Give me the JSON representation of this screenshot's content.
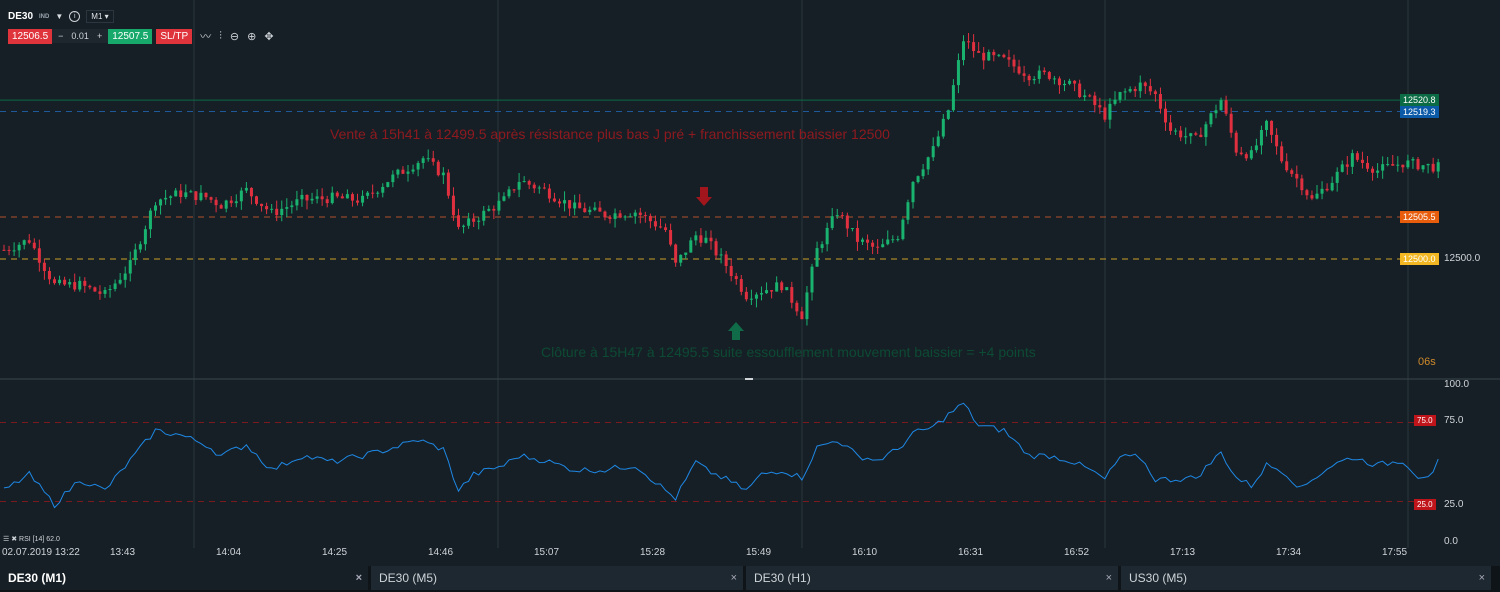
{
  "header": {
    "symbol": "DE30",
    "type": "IND",
    "timeframe": "M1"
  },
  "trade": {
    "bid": "12506.5",
    "lot_minus": "−",
    "lot": "0.01",
    "lot_plus": "+",
    "ask": "12507.5",
    "sltp": "SL/TP"
  },
  "price_labels": [
    {
      "value": "12520.8",
      "color": "#0b6b44"
    },
    {
      "value": "12519.3",
      "color": "#0b5aa8"
    },
    {
      "value": "12505.5",
      "color": "#e85d0c"
    },
    {
      "value": "12500.0",
      "color": "#f2b722"
    }
  ],
  "price_axis": {
    "label": "12500.0",
    "countdown": "06s"
  },
  "annotations": {
    "sell": "Vente à 15h41 à 12499.5 après résistance plus bas J pré + franchissement baissier 12500",
    "close": "Clôture à 15H47 à 12495.5 suite essoufflement mouvement baissier = +4 points"
  },
  "rsi": {
    "label": "RSI [14] 62.0",
    "axis": [
      "100.0",
      "75.0",
      "25.0",
      "0.0"
    ],
    "levels": [
      "75.0",
      "25.0"
    ]
  },
  "time_axis": [
    "02.07.2019 13:22",
    "13:43",
    "14:04",
    "14:25",
    "14:46",
    "15:07",
    "15:28",
    "15:49",
    "16:10",
    "16:31",
    "16:52",
    "17:13",
    "17:34",
    "17:55"
  ],
  "tabs": [
    {
      "label": "DE30 (M1)",
      "active": true
    },
    {
      "label": "DE30 (M5)"
    },
    {
      "label": "DE30 (H1)"
    },
    {
      "label": "US30 (M5)"
    }
  ],
  "colors": {
    "up": "#19b36f",
    "down": "#e0303f",
    "rsi": "#1e88e5",
    "bg": "#161f26"
  },
  "chart_data": {
    "type": "candlestick",
    "x_unit": "minutes since 13:22",
    "price_keypoints": [
      [
        0,
        12501.2
      ],
      [
        5,
        12502.5
      ],
      [
        10,
        12496.6
      ],
      [
        15,
        12496.6
      ],
      [
        20,
        12495.3
      ],
      [
        25,
        12499.2
      ],
      [
        30,
        12507.7
      ],
      [
        35,
        12508.6
      ],
      [
        40,
        12508.1
      ],
      [
        43,
        12507.1
      ],
      [
        48,
        12509.0
      ],
      [
        53,
        12506.0
      ],
      [
        59,
        12507.7
      ],
      [
        65,
        12508.0
      ],
      [
        71,
        12507.7
      ],
      [
        76,
        12510.3
      ],
      [
        83,
        12513.2
      ],
      [
        87,
        12511.0
      ],
      [
        90,
        12503.8
      ],
      [
        93,
        12505.1
      ],
      [
        99,
        12507.7
      ],
      [
        102,
        12510.3
      ],
      [
        107,
        12509.0
      ],
      [
        113,
        12506.7
      ],
      [
        119,
        12505.8
      ],
      [
        125,
        12506.2
      ],
      [
        131,
        12503.8
      ],
      [
        133,
        12499.2
      ],
      [
        137,
        12503.1
      ],
      [
        139,
        12502.5
      ],
      [
        143,
        12499.2
      ],
      [
        147,
        12495.3
      ],
      [
        150,
        12495.9
      ],
      [
        154,
        12496.6
      ],
      [
        158,
        12492.7
      ],
      [
        161,
        12501.2
      ],
      [
        165,
        12506.2
      ],
      [
        169,
        12502.5
      ],
      [
        173,
        12501.2
      ],
      [
        177,
        12503.1
      ],
      [
        180,
        12510.3
      ],
      [
        184,
        12514.3
      ],
      [
        187,
        12519.5
      ],
      [
        190,
        12528.7
      ],
      [
        193,
        12526.7
      ],
      [
        198,
        12526.0
      ],
      [
        203,
        12524.1
      ],
      [
        207,
        12524.1
      ],
      [
        211,
        12522.8
      ],
      [
        215,
        12520.8
      ],
      [
        218,
        12518.8
      ],
      [
        221,
        12521.5
      ],
      [
        225,
        12522.8
      ],
      [
        228,
        12521.5
      ],
      [
        231,
        12516.9
      ],
      [
        236,
        12515.6
      ],
      [
        241,
        12520.8
      ],
      [
        244,
        12514.3
      ],
      [
        247,
        12513.6
      ],
      [
        250,
        12517.5
      ],
      [
        253,
        12513.0
      ],
      [
        257,
        12509.7
      ],
      [
        259,
        12507.7
      ],
      [
        263,
        12510.3
      ],
      [
        267,
        12513.4
      ],
      [
        272,
        12511.6
      ],
      [
        277,
        12512.6
      ],
      [
        284,
        12512.0
      ]
    ],
    "rsi_keypoints": [
      [
        0,
        32
      ],
      [
        5,
        42
      ],
      [
        10,
        23
      ],
      [
        15,
        39
      ],
      [
        20,
        32
      ],
      [
        25,
        51
      ],
      [
        30,
        70
      ],
      [
        35,
        67
      ],
      [
        40,
        61
      ],
      [
        43,
        54
      ],
      [
        48,
        61
      ],
      [
        53,
        45
      ],
      [
        59,
        54
      ],
      [
        65,
        50
      ],
      [
        71,
        54
      ],
      [
        76,
        58
      ],
      [
        82,
        64
      ],
      [
        87,
        58
      ],
      [
        90,
        32
      ],
      [
        93,
        42
      ],
      [
        99,
        48
      ],
      [
        102,
        54
      ],
      [
        107,
        51
      ],
      [
        113,
        45
      ],
      [
        119,
        45
      ],
      [
        125,
        48
      ],
      [
        131,
        32
      ],
      [
        133,
        27
      ],
      [
        137,
        50
      ],
      [
        139,
        45
      ],
      [
        143,
        39
      ],
      [
        147,
        32
      ],
      [
        150,
        42
      ],
      [
        154,
        45
      ],
      [
        158,
        40
      ],
      [
        161,
        59
      ],
      [
        165,
        64
      ],
      [
        169,
        54
      ],
      [
        173,
        51
      ],
      [
        177,
        58
      ],
      [
        180,
        68
      ],
      [
        184,
        72
      ],
      [
        187,
        80
      ],
      [
        190,
        87
      ],
      [
        193,
        73
      ],
      [
        198,
        70
      ],
      [
        203,
        54
      ],
      [
        207,
        54
      ],
      [
        211,
        51
      ],
      [
        215,
        45
      ],
      [
        218,
        39
      ],
      [
        221,
        53
      ],
      [
        225,
        53
      ],
      [
        228,
        39
      ],
      [
        231,
        39
      ],
      [
        236,
        40
      ],
      [
        241,
        56
      ],
      [
        244,
        40
      ],
      [
        247,
        35
      ],
      [
        250,
        48
      ],
      [
        253,
        45
      ],
      [
        257,
        33
      ],
      [
        259,
        39
      ],
      [
        263,
        48
      ],
      [
        267,
        53
      ],
      [
        272,
        48
      ],
      [
        277,
        51
      ],
      [
        280,
        41
      ],
      [
        283,
        42
      ],
      [
        284,
        50
      ]
    ],
    "levels": [
      12520.8,
      12519.3,
      12505.5,
      12500.0
    ],
    "rsi_levels": [
      75,
      25
    ]
  }
}
